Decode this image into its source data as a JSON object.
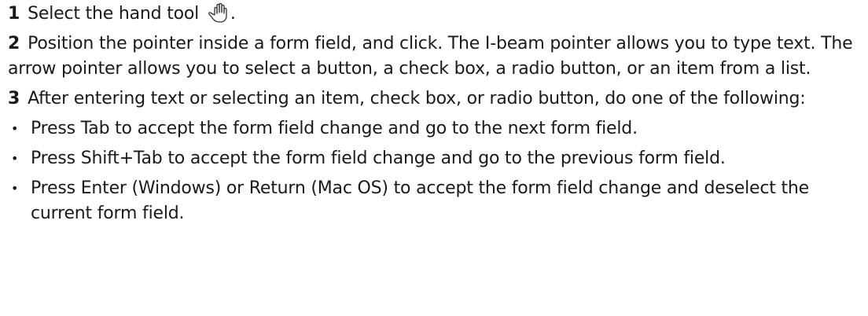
{
  "steps": [
    {
      "number": "1",
      "text": "Select the hand tool",
      "icon": "hand-tool-icon",
      "trailing": "."
    },
    {
      "number": "2",
      "text": "Position the pointer inside a form field, and click. The I-beam pointer allows you to type text. The arrow pointer allows you to select a button, a check box, a radio button, or an item from a list."
    },
    {
      "number": "3",
      "text": "After entering text or selecting an item, check box, or radio button, do one of the following:"
    }
  ],
  "bullets": [
    "Press Tab to accept the form field change and go to the next form field.",
    "Press Shift+Tab to accept the form field change and go to the previous form field.",
    "Press Enter (Windows) or Return (Mac OS) to accept the form field change and deselect the current form field."
  ],
  "bullet_glyph": "•"
}
